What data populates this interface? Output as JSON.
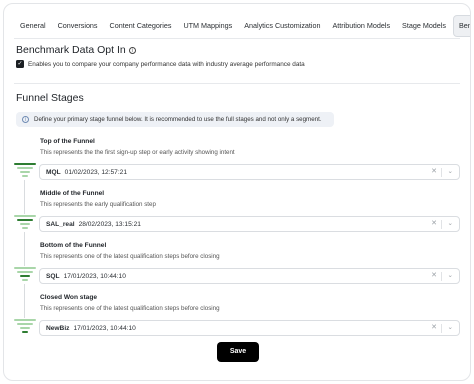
{
  "tabs": [
    {
      "label": "General"
    },
    {
      "label": "Conversions"
    },
    {
      "label": "Content Categories"
    },
    {
      "label": "UTM Mappings"
    },
    {
      "label": "Analytics Customization"
    },
    {
      "label": "Attribution Models"
    },
    {
      "label": "Stage Models"
    },
    {
      "label": "Benchmark"
    }
  ],
  "active_tab": "Benchmark",
  "benchmark": {
    "title": "Benchmark Data Opt In",
    "optin_label": "Enables you to compare your company performance data with industry average performance data",
    "optin_checked": true
  },
  "funnel": {
    "title": "Funnel Stages",
    "note": "Define your primary stage funnel below. It is recommended to use the full stages and not only a segment.",
    "stages": [
      {
        "title": "Top of the Funnel",
        "desc": "This represents the the first sign-up step or early activity showing intent",
        "code": "MQL",
        "date": "01/02/2023, 12:57:21"
      },
      {
        "title": "Middle of the Funnel",
        "desc": "This represents the early qualification step",
        "code": "SAL_real",
        "date": "28/02/2023, 13:15:21"
      },
      {
        "title": "Bottom of the Funnel",
        "desc": "This represents one of the latest qualification steps before closing",
        "code": "SQL",
        "date": "17/01/2023, 10:44:10"
      },
      {
        "title": "Closed Won stage",
        "desc": "This represents one of the latest qualification steps before closing",
        "code": "NewBiz",
        "date": "17/01/2023, 10:44:10"
      }
    ]
  },
  "icons": {
    "clear": "✕",
    "chevron": "⌄",
    "info": "i",
    "check": "✓"
  },
  "colors": {
    "funnel_active": "#2e7d32",
    "funnel_inactive": "#a9d6a9",
    "button": "#000000",
    "note_bg": "#eef1f6"
  },
  "save_label": "Save"
}
